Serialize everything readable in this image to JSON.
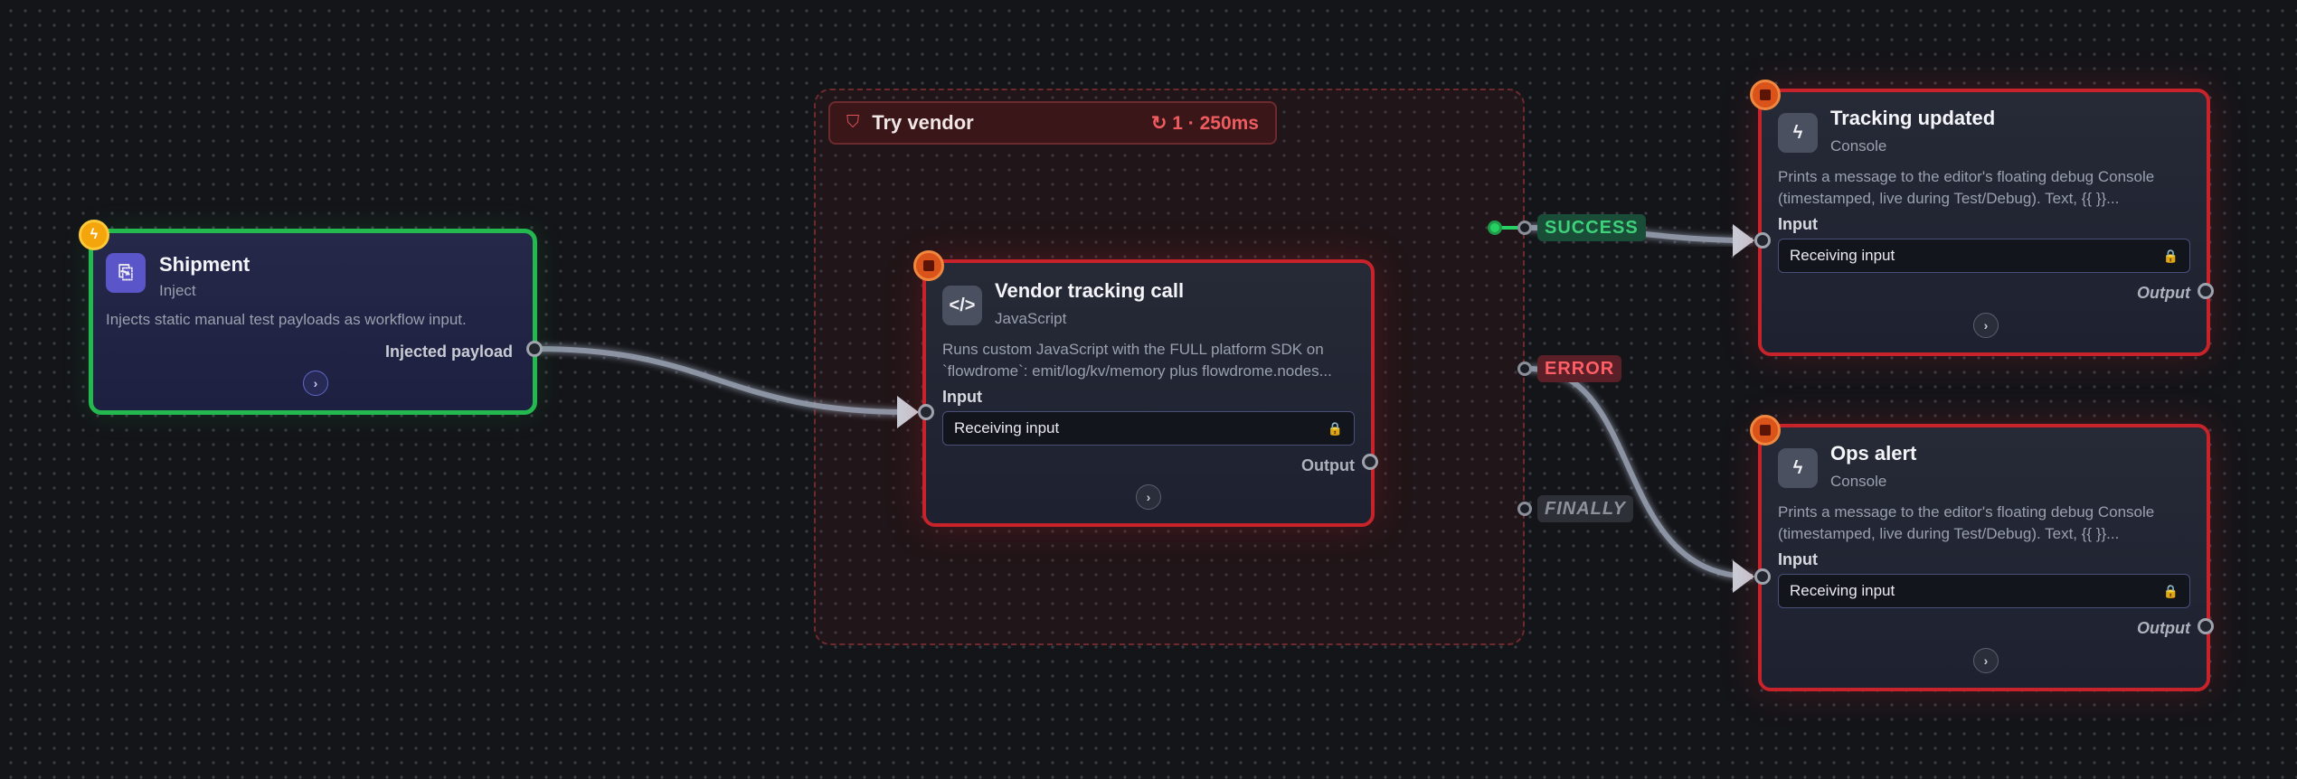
{
  "group": {
    "title": "Try vendor",
    "retry": "↻ 1 · 250ms",
    "icon": "shield-icon"
  },
  "nodes": {
    "shipment": {
      "title": "Shipment",
      "subtitle": "Inject",
      "description": "Injects static manual test payloads as workflow input.",
      "output_label": "Injected payload",
      "icon": "file-inject-icon",
      "badge_icon": "bolt-icon"
    },
    "vendor": {
      "title": "Vendor tracking call",
      "subtitle": "JavaScript",
      "description_line1": "Runs custom JavaScript with the FULL platform SDK on",
      "description_line2": "`flowdrome`: emit/log/kv/memory plus flowdrome.nodes...",
      "input_label": "Input",
      "input_value": "Receiving input",
      "output_label": "Output",
      "icon": "code-icon"
    },
    "tracking": {
      "title": "Tracking updated",
      "subtitle": "Console",
      "description_line1": "Prints a message to the editor's floating debug Console",
      "description_line2": "(timestamped, live during Test/Debug). Text, {{ }}...",
      "input_label": "Input",
      "input_value": "Receiving input",
      "output_label": "Output",
      "icon": "bolt-icon"
    },
    "ops": {
      "title": "Ops alert",
      "subtitle": "Console",
      "description_line1": "Prints a message to the editor's floating debug Console",
      "description_line2": "(timestamped, live during Test/Debug). Text, {{ }}...",
      "input_label": "Input",
      "input_value": "Receiving input",
      "output_label": "Output",
      "icon": "bolt-icon"
    }
  },
  "branches": {
    "success": "SUCCESS",
    "error": "ERROR",
    "finally": "FINALLY"
  },
  "colors": {
    "error_border": "#c8232a",
    "trigger_border": "#23b94e",
    "success": "#3fd07a",
    "error": "#ff5e67"
  }
}
